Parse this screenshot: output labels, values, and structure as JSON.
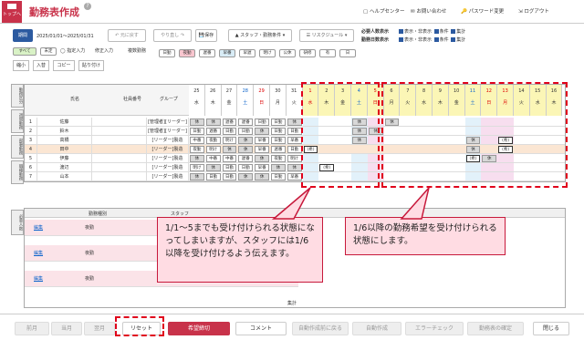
{
  "header": {
    "top_button": "トップへ",
    "title": "勤務表作成",
    "links": [
      "ヘルプセンター",
      "お問い合わせ",
      "パスワード変更",
      "ログアウト"
    ]
  },
  "toolbar": {
    "period_tag": "期間",
    "period": "2025/01/01～2025/01/31",
    "undo": "元に戻す",
    "redo": "やり直し",
    "save": "保存",
    "staff_filter": "スタッフ・勤務条件",
    "risk": "リスクジュール",
    "required_label": "必要人数表示",
    "required_opts": [
      "表示・非表示",
      "条件",
      "集計"
    ],
    "days_label": "勤務日数表示",
    "days_opts": [
      "表示・非表示",
      "条件",
      "集計"
    ]
  },
  "legend": [
    "すべて",
    "未定",
    "日勤",
    "夜勤",
    "遅番",
    "早番",
    "早遅",
    "明け",
    "公休",
    "研修",
    "有",
    "日"
  ],
  "tools": {
    "designate": "指定入力",
    "fix": "修正入力",
    "multi": "複数勤務",
    "shrink": "縮小",
    "enter": "入替",
    "copy": "コピー",
    "paste": "貼り付け"
  },
  "side_tabs": [
    "勤務区分",
    "週間勤務",
    "部署勤務",
    "職種勤務"
  ],
  "side_tab2": "必要人数",
  "grid1": {
    "col_name": "氏名",
    "col_id": "社員番号",
    "col_group": "グループ",
    "days": [
      {
        "d": "25",
        "w": "水",
        "c": ""
      },
      {
        "d": "26",
        "w": "木",
        "c": ""
      },
      {
        "d": "27",
        "w": "金",
        "c": ""
      },
      {
        "d": "28",
        "w": "土",
        "c": "blue"
      },
      {
        "d": "29",
        "w": "日",
        "c": "red"
      },
      {
        "d": "30",
        "w": "月",
        "c": ""
      },
      {
        "d": "31",
        "w": "火",
        "c": ""
      },
      {
        "d": "1",
        "w": "水",
        "c": "red"
      },
      {
        "d": "2",
        "w": "木",
        "c": ""
      },
      {
        "d": "3",
        "w": "金",
        "c": ""
      },
      {
        "d": "4",
        "w": "土",
        "c": "blue"
      },
      {
        "d": "5",
        "w": "日",
        "c": "red"
      },
      {
        "d": "6",
        "w": "月",
        "c": ""
      },
      {
        "d": "7",
        "w": "火",
        "c": ""
      },
      {
        "d": "8",
        "w": "水",
        "c": ""
      },
      {
        "d": "9",
        "w": "木",
        "c": ""
      },
      {
        "d": "10",
        "w": "金",
        "c": ""
      },
      {
        "d": "11",
        "w": "土",
        "c": "blue"
      },
      {
        "d": "12",
        "w": "日",
        "c": "red"
      },
      {
        "d": "13",
        "w": "月",
        "c": "red"
      },
      {
        "d": "14",
        "w": "火",
        "c": ""
      },
      {
        "d": "15",
        "w": "水",
        "c": ""
      },
      {
        "d": "16",
        "w": "木",
        "c": ""
      }
    ],
    "staff": [
      {
        "no": "1",
        "name": "佐藤",
        "group": "[管理者][リーダー]",
        "s": [
          "休",
          "休",
          "遅番",
          "遅番",
          "日勤",
          "日勤",
          "休"
        ]
      },
      {
        "no": "2",
        "name": "鈴木",
        "group": "[管理者][リーダー]",
        "s": [
          "日勤",
          "遅番",
          "日勤",
          "日勤",
          "休",
          "日勤",
          "日勤"
        ]
      },
      {
        "no": "3",
        "name": "高橋",
        "group": "[リーダー]製造",
        "s": [
          "中番",
          "夜勤",
          "明け",
          "休",
          "早番",
          "日勤",
          "早番"
        ]
      },
      {
        "no": "4",
        "name": "田中",
        "group": "[リーダー]製造",
        "s": [
          "夜勤",
          "明け",
          "休",
          "休",
          "早番",
          "遅番",
          "日勤"
        ]
      },
      {
        "no": "5",
        "name": "伊藤",
        "group": "[リーダー]製造",
        "s": [
          "休",
          "中番",
          "中番",
          "遅番",
          "休",
          "夜勤",
          "明け"
        ]
      },
      {
        "no": "6",
        "name": "渡辺",
        "group": "[リーダー]製造",
        "s": [
          "明け",
          "休",
          "日勤",
          "日勤",
          "早番",
          "休",
          "休"
        ]
      },
      {
        "no": "7",
        "name": "山本",
        "group": "[リーダー]製造",
        "s": [
          "休",
          "日勤",
          "日勤",
          "休",
          "休",
          "日勤",
          "早番"
        ]
      }
    ],
    "hope_mark": "(希)",
    "off_mark": "休"
  },
  "grid2": {
    "col_type": "勤務種別",
    "col_staff": "スタッフ",
    "col_count": "人数",
    "rows": [
      {
        "edit": "編集",
        "type": "夜勤",
        "staff": "[未設定]"
      },
      {
        "edit": "編集",
        "type": "夜勤",
        "staff": "[未設定]"
      },
      {
        "edit": "編集",
        "type": "夜勤",
        "staff": "[未設定]"
      }
    ],
    "total": "集計"
  },
  "footer": {
    "prev": "前月",
    "this": "当月",
    "next": "翌月",
    "reset": "リセット",
    "hope_close": "希望締切",
    "comment": "コメント",
    "back_auto": "自動作成前に戻る",
    "auto": "自動作成",
    "error": "エラーチェック",
    "confirm": "勤務表の確定",
    "close": "閉じる"
  },
  "callouts": {
    "left": "1/1～5までも受け付けられる状態になってしまいますが、スタッフには1/6以降を受け付けるよう伝えます。",
    "right": "1/6以降の勤務希望を受け付けられる状態にします。"
  },
  "colors": {
    "accent": "#c8324a",
    "highlight": "#e0001b",
    "callout_bg": "#ffdce3"
  }
}
